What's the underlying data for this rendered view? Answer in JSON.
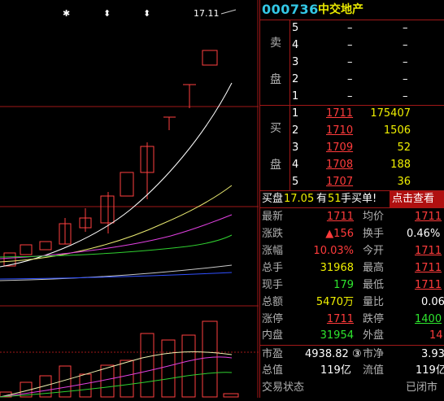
{
  "stock": {
    "code": "000736",
    "name": "中交地产"
  },
  "chart_markers": {
    "star": "✱",
    "diamond": "⬍",
    "peak_value": "17.11",
    "peak_arrow": "→"
  },
  "sell_book": {
    "label": [
      "卖",
      "盘"
    ],
    "rows": [
      {
        "level": "5",
        "price": "–",
        "volume": "–"
      },
      {
        "level": "4",
        "price": "–",
        "volume": "–"
      },
      {
        "level": "3",
        "price": "–",
        "volume": "–"
      },
      {
        "level": "2",
        "price": "–",
        "volume": "–"
      },
      {
        "level": "1",
        "price": "–",
        "volume": "–"
      }
    ]
  },
  "buy_book": {
    "label": [
      "买",
      "盘"
    ],
    "rows": [
      {
        "level": "1",
        "price": "1711",
        "volume": "175407"
      },
      {
        "level": "2",
        "price": "1710",
        "volume": "1506"
      },
      {
        "level": "3",
        "price": "1709",
        "volume": "52"
      },
      {
        "level": "4",
        "price": "1708",
        "volume": "188"
      },
      {
        "level": "5",
        "price": "1707",
        "volume": "36"
      }
    ]
  },
  "banner": {
    "prefix": "买盘",
    "price": "17.05",
    "mid1": "有",
    "qty": "51",
    "mid2": "手买单!",
    "click_label": "点击查看"
  },
  "quote": {
    "left": [
      {
        "label": "最新",
        "value": "1711",
        "color": "red",
        "underline": true
      },
      {
        "label": "涨跌",
        "value": "▲156",
        "color": "red"
      },
      {
        "label": "涨幅",
        "value": "10.03%",
        "color": "red"
      },
      {
        "label": "总手",
        "value": "31968",
        "color": "yellow"
      },
      {
        "label": "现手",
        "value": "179",
        "color": "green"
      },
      {
        "label": "总额",
        "value": "5470万",
        "color": "yellow"
      },
      {
        "label": "涨停",
        "value": "1711",
        "color": "red",
        "underline": true
      },
      {
        "label": "内盘",
        "value": "31954",
        "color": "green"
      }
    ],
    "right": [
      {
        "label": "均价",
        "value": "1711",
        "color": "red",
        "underline": true
      },
      {
        "label": "换手",
        "value": "0.46%",
        "color": "white"
      },
      {
        "label": "今开",
        "value": "1711",
        "color": "red",
        "underline": true
      },
      {
        "label": "最高",
        "value": "1711",
        "color": "red",
        "underline": true
      },
      {
        "label": "最低",
        "value": "1711",
        "color": "red",
        "underline": true
      },
      {
        "label": "量比",
        "value": "0.06",
        "color": "white"
      },
      {
        "label": "跌停",
        "value": "1400",
        "color": "green",
        "underline": true
      },
      {
        "label": "外盘",
        "value": "14",
        "color": "red"
      }
    ]
  },
  "fundamentals": {
    "pe_label": "市盈",
    "pe_value": "4938.82",
    "pe_badge": "③",
    "pb_label": "市净",
    "pb_value": "3.93",
    "total_value_label": "总值",
    "total_value": "119亿",
    "float_value_label": "流值",
    "float_value": "119亿",
    "status_label": "交易状态",
    "status_value": "已闭市"
  },
  "colors": {
    "grid": "#a01818",
    "up": "#ff3b3b",
    "ma5": "#ffffff",
    "ma10": "#e8e870",
    "ma20": "#e040e0",
    "ma30": "#30d030",
    "ma60": "#c8c8c8",
    "ma120": "#3050ff"
  }
}
